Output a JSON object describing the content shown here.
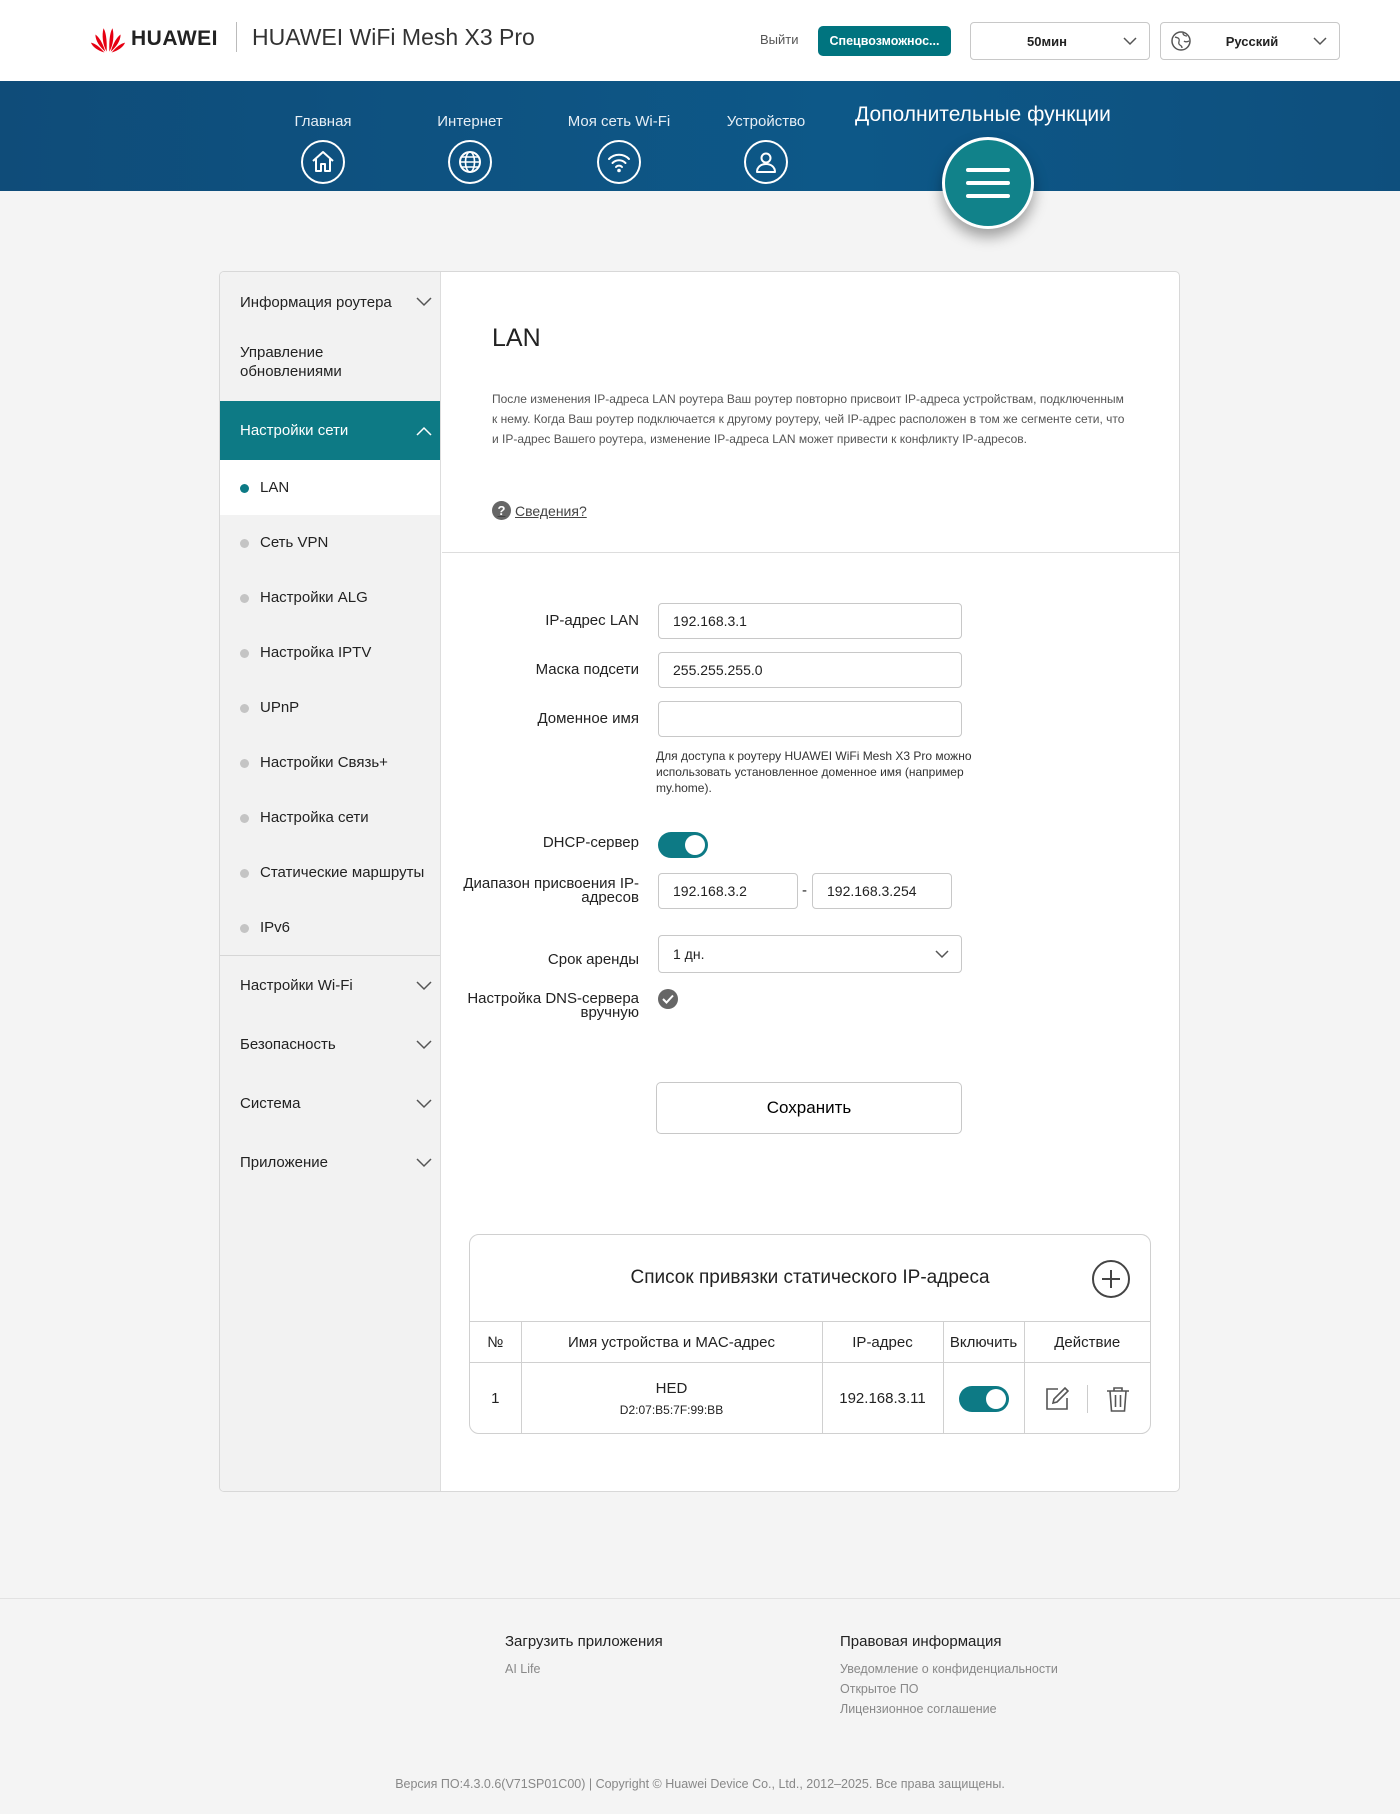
{
  "header": {
    "brand": "HUAWEI",
    "product": "HUAWEI WiFi Mesh X3 Pro",
    "logout": "Выйти",
    "accessibility": "Спецвозможнос...",
    "timeout": "50мин",
    "language": "Русский"
  },
  "nav": {
    "home": "Главная",
    "internet": "Интернет",
    "wifi": "Моя сеть Wi-Fi",
    "devices": "Устройство",
    "advanced": "Дополнительные функции"
  },
  "sidebar": {
    "router_info": "Информация роутера",
    "update_line1": "Управление",
    "update_line2": "обновлениями",
    "network": "Настройки сети",
    "subitems": [
      "LAN",
      "Сеть VPN",
      "Настройки ALG",
      "Настройка IPTV",
      "UPnP",
      "Настройки Связь+",
      "Настройка сети",
      "Статические маршруты",
      "IPv6"
    ],
    "wifi": "Настройки Wi-Fi",
    "security": "Безопасность",
    "system": "Система",
    "apps": "Приложение"
  },
  "lan": {
    "title": "LAN",
    "description": "После изменения IP-адреса LAN роутера Ваш роутер повторно присвоит IP-адреса устройствам, подключенным к нему. Когда Ваш роутер подключается к другому роутеру, чей IP-адрес расположен в том же сегменте сети, что и IP-адрес Вашего роутера, изменение IP-адреса LAN может привести к конфликту IP-адресов.",
    "help": "Сведения?",
    "ip_label": "IP-адрес LAN",
    "ip_value": "192.168.3.1",
    "mask_label": "Маска подсети",
    "mask_value": "255.255.255.0",
    "domain_label": "Доменное имя",
    "domain_value": "",
    "domain_hint": "Для доступа к роутеру HUAWEI WiFi Mesh X3 Pro можно использовать установленное доменное имя (например my.home).",
    "dhcp_label": "DHCP-сервер",
    "dhcp_enabled": true,
    "range_label_1": "Диапазон присвоения IP-",
    "range_label_2": "адресов",
    "range_start": "192.168.3.2",
    "range_dash": "-",
    "range_end": "192.168.3.254",
    "lease_label": "Срок аренды",
    "lease_value": "1 дн.",
    "dns_label_1": "Настройка DNS-сервера",
    "dns_label_2": "вручную",
    "dns_manual": true,
    "save": "Сохранить"
  },
  "static_table": {
    "title": "Список привязки статического IP-адреса",
    "columns": [
      "№",
      "Имя устройства и MAC-адрес",
      "IP-адрес",
      "Включить",
      "Действие"
    ],
    "rows": [
      {
        "no": "1",
        "name": "HED",
        "mac": "D2:07:B5:7F:99:BB",
        "ip": "192.168.3.11",
        "enabled": true
      }
    ]
  },
  "footer": {
    "download_head": "Загрузить приложения",
    "download_link": "AI Life",
    "legal_head": "Правовая информация",
    "legal_links": [
      "Уведомление о конфиденциальности",
      "Открытое ПО",
      "Лицензионное соглашение"
    ],
    "copyright": "Версия ПО:4.3.0.6(V71SP01C00) | Copyright © Huawei Device Co., Ltd., 2012–2025. Все права защищены."
  },
  "colors": {
    "accent": "#0d7a85",
    "nav_bg": "#0d5888"
  }
}
